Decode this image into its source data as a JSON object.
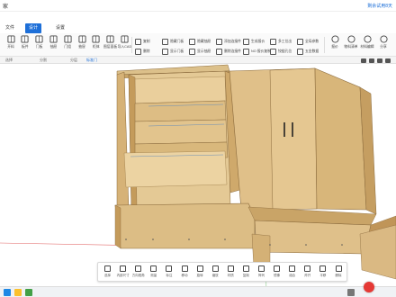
{
  "window": {
    "title": "家",
    "trial_text": "剩余试用8天"
  },
  "menu": {
    "tabs": [
      "文件",
      "设计",
      "设置"
    ],
    "active_index": 1
  },
  "toolbar": {
    "large_tools": [
      {
        "label": "开料",
        "icon": "cut-icon"
      },
      {
        "label": "板件",
        "icon": "board-icon"
      },
      {
        "label": "门板",
        "icon": "door-icon"
      },
      {
        "label": "抽屉",
        "icon": "drawer-icon"
      },
      {
        "label": "门组",
        "icon": "door-group-icon"
      },
      {
        "label": "抽屉",
        "icon": "drawer-group-icon"
      },
      {
        "label": "柜体",
        "icon": "cabinet-icon"
      },
      {
        "label": "图层面板",
        "icon": "layer-icon"
      },
      {
        "label": "导入CAD",
        "icon": "cad-import-icon"
      }
    ],
    "small_tools": [
      {
        "label": "复制",
        "icon": "copy-icon"
      },
      {
        "label": "删除",
        "icon": "delete-icon"
      },
      {
        "label": "隐藏门板",
        "icon": "hide-door-icon"
      },
      {
        "label": "显示门板",
        "icon": "show-door-icon"
      },
      {
        "label": "隐藏抽屉",
        "icon": "hide-drawer-icon"
      },
      {
        "label": "显示抽屉",
        "icon": "show-drawer-icon"
      },
      {
        "label": "添加连接件",
        "icon": "connector-icon"
      },
      {
        "label": "删除连接件",
        "icon": "delete-connector-icon"
      },
      {
        "label": "生成报价",
        "icon": "quote-icon"
      },
      {
        "label": "NO 报价复制",
        "icon": "quote-copy-icon"
      },
      {
        "label": "多工位出",
        "icon": "multi-station-icon"
      },
      {
        "label": "铰链孔位",
        "icon": "hinge-icon"
      },
      {
        "label": "全局参数",
        "icon": "global-param-icon"
      },
      {
        "label": "五金数据",
        "icon": "hardware-icon"
      }
    ],
    "right_tools": [
      {
        "label": "报价",
        "icon": "price-icon"
      },
      {
        "label": "物料清单",
        "icon": "bom-icon"
      },
      {
        "label": "材料编辑",
        "icon": "material-icon"
      },
      {
        "label": "分享",
        "icon": "share-icon"
      }
    ]
  },
  "subbar": {
    "labels": [
      "选择",
      "分割",
      "分层"
    ],
    "active_label": "标准门"
  },
  "bottom_toolbar": {
    "tools": [
      {
        "label": "选择",
        "icon": "select-icon"
      },
      {
        "label": "内部尺寸",
        "icon": "inner-size-icon"
      },
      {
        "label": "方向视角",
        "icon": "view-icon"
      },
      {
        "label": "测量",
        "icon": "measure-icon"
      },
      {
        "label": "标注",
        "icon": "annotate-icon"
      },
      {
        "label": "移动",
        "icon": "move-icon"
      },
      {
        "label": "旋转",
        "icon": "rotate-icon"
      },
      {
        "label": "缩放",
        "icon": "scale-icon"
      },
      {
        "label": "材质",
        "icon": "texture-icon"
      },
      {
        "label": "复制",
        "icon": "copy2-icon"
      },
      {
        "label": "阵列",
        "icon": "array-icon"
      },
      {
        "label": "镜像",
        "icon": "mirror-icon"
      },
      {
        "label": "组合",
        "icon": "group-icon"
      },
      {
        "label": "炸开",
        "icon": "explode-icon"
      },
      {
        "label": "平移",
        "icon": "pan-icon"
      },
      {
        "label": "删除",
        "icon": "erase-icon"
      }
    ]
  },
  "colors": {
    "accent": "#1d6fd8",
    "wood_light": "#e8c98e",
    "wood_mid": "#d9b473",
    "wood_dark": "#b98e4e",
    "record": "#e53935"
  }
}
